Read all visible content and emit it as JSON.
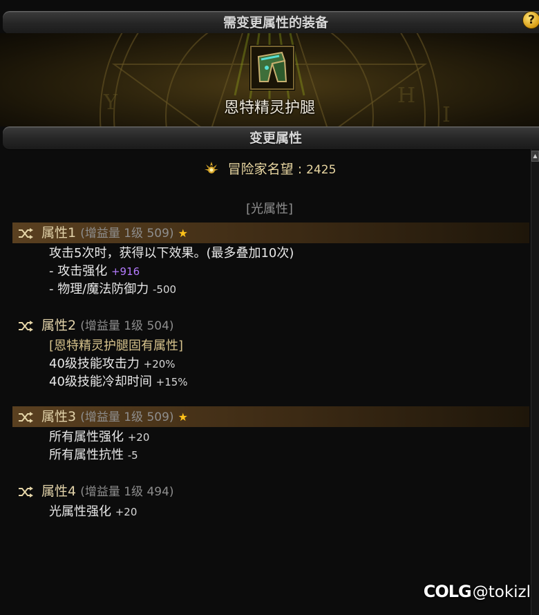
{
  "header": {
    "equipment_title": "需变更属性的装备",
    "help_glyph": "?"
  },
  "item": {
    "name": "恩特精灵护腿",
    "icon": "leg-armor-icon"
  },
  "change_section": {
    "title": "变更属性"
  },
  "fame": {
    "label": "冒险家名望",
    "separator": ":",
    "value": "2425",
    "icon": "fame-emblem-icon"
  },
  "element_tag": "[光属性]",
  "attributes": [
    {
      "name": "属性1",
      "meta": "(增益量 1级 509)",
      "starred": true,
      "star": "★",
      "highlighted": true,
      "lines": [
        {
          "text": "攻击5次时，获得以下效果。(最多叠加10次)",
          "value": ""
        },
        {
          "text": "- 攻击强化 ",
          "value": "+916"
        },
        {
          "text": "- 物理/魔法防御力 ",
          "value": "-500"
        }
      ]
    },
    {
      "name": "属性2",
      "meta": "(增益量 1级 504)",
      "starred": false,
      "highlighted": false,
      "lines": [
        {
          "text": "[恩特精灵护腿固有属性]",
          "value": ""
        },
        {
          "text": "40级技能攻击力 ",
          "value": "+20%"
        },
        {
          "text": "40级技能冷却时间 ",
          "value": "+15%"
        }
      ]
    },
    {
      "name": "属性3",
      "meta": "(增益量 1级 509)",
      "starred": true,
      "star": "★",
      "highlighted": true,
      "lines": [
        {
          "text": "所有属性强化 ",
          "value": "+20"
        },
        {
          "text": "所有属性抗性 ",
          "value": "-5"
        }
      ]
    },
    {
      "name": "属性4",
      "meta": "(增益量 1级 494)",
      "starred": false,
      "highlighted": false,
      "lines": [
        {
          "text": "光属性强化 ",
          "value": "+20"
        }
      ]
    }
  ],
  "watermark": {
    "logo": "COLG",
    "handle": "@tokizl"
  },
  "colors": {
    "accent_gold": "#e2d3aa",
    "highlight_row": "#5a4020",
    "star": "#ffc21a",
    "purple_value": "#b57bff",
    "background": "#0c0c0c"
  }
}
